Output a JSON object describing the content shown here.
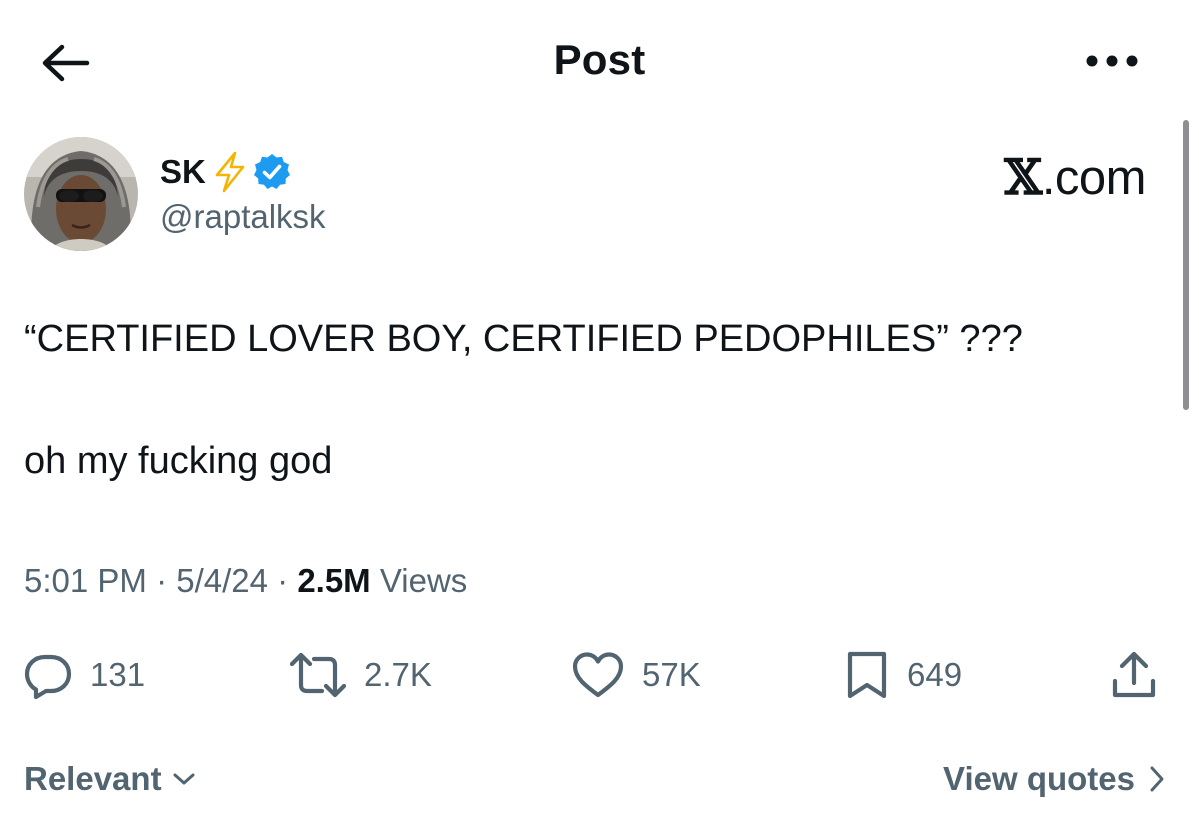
{
  "header": {
    "title": "Post",
    "back_icon": "arrow-left-icon",
    "more_icon": "more-horizontal-icon"
  },
  "author": {
    "display_name": "SK",
    "name_emoji": "lightning-bolt-icon",
    "verified_icon": "verified-badge-icon",
    "handle": "@raptalksk",
    "avatar": "avatar"
  },
  "watermark": {
    "x": "𝕏",
    "text": ".com"
  },
  "post": {
    "line1": "“CERTIFIED LOVER BOY, CERTIFIED PEDOPHILES” ???",
    "line2": "oh my fucking god"
  },
  "meta": {
    "time": "5:01 PM",
    "sep1": " · ",
    "date": "5/4/24",
    "sep2": " · ",
    "views_count": "2.5M",
    "views_label": " Views"
  },
  "actions": {
    "replies": "131",
    "reposts": "2.7K",
    "likes": "57K",
    "bookmarks": "649"
  },
  "footer": {
    "sort_label": "Relevant",
    "quotes_label": "View quotes"
  },
  "colors": {
    "text": "#0f1419",
    "secondary": "#536471",
    "verified": "#1d9bf0",
    "bolt": "#f4b400"
  }
}
